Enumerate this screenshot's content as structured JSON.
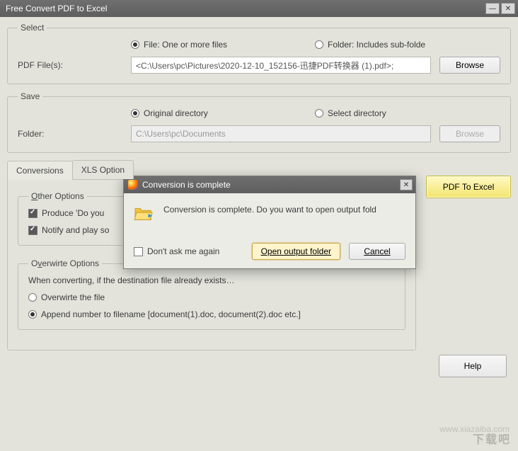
{
  "window_title": "Free Convert PDF to Excel",
  "select": {
    "legend": "Select",
    "file_radio": "File:  One or more files",
    "folder_radio": "Folder: Includes sub-folde",
    "pdf_label": "PDF File(s):",
    "pdf_value": "<C:\\Users\\pc\\Pictures\\2020-12-10_152156-迅捷PDF转换器 (1).pdf>;",
    "browse": "Browse"
  },
  "save": {
    "legend": "Save",
    "orig_radio": "Original directory",
    "select_radio": "Select directory",
    "folder_label": "Folder:",
    "folder_value": "C:\\Users\\pc\\Documents",
    "browse": "Browse"
  },
  "tabs": {
    "conversions": "Conversions",
    "xls_options": "XLS Option"
  },
  "other": {
    "legend": "Other Options",
    "produce": "Produce 'Do you",
    "notify": "Notify and play so"
  },
  "overwrite": {
    "legend": "Overwirte Options",
    "desc": "When converting, if the destination file already exists…",
    "opt1": "Overwirte the file",
    "opt2": "Append number to filename  [document(1).doc, document(2).doc etc.]"
  },
  "pdf_to_excel": "PDF To Excel",
  "help": "Help",
  "modal": {
    "title": "Conversion is complete",
    "message": "Conversion is complete. Do you want to open output fold",
    "dont_ask": "Don't ask me again",
    "open": "Open output folder",
    "cancel": "Cancel"
  },
  "watermark_main": "下载吧",
  "watermark_sub": "www.xiazaiba.com"
}
